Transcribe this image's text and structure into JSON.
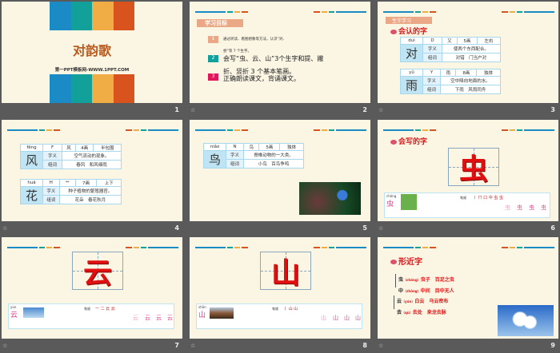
{
  "colors": {
    "blue": "#1a8bc4",
    "teal": "#12a09a",
    "yellow": "#f0ad45",
    "red": "#d9531e",
    "title": "#b85a1e",
    "accent_red": "#d81818"
  },
  "transition_icon": "animation-star-icon",
  "slides": [
    {
      "number": "1",
      "title": "对韵歌",
      "subtitle": "第一PPT模板网-WWW.1PPT.COM"
    },
    {
      "number": "2",
      "badge": "学习目标",
      "goals": [
        {
          "n": "1",
          "text": "通过听读、看图想象等方法，认识“对、",
          "text2": "尝”等 7 个生字。"
        },
        {
          "n": "2",
          "text": "会写“虫、云、山”3个生字和提、撇",
          "text2": "折、竖折 3 个基本笔画。"
        },
        {
          "n": "3",
          "text": "正确朗读课文，背诵课文。"
        }
      ]
    },
    {
      "number": "3",
      "badge": "生字学习",
      "section": "会认的字",
      "chars": [
        {
          "pinyin": "duì",
          "letter": "D",
          "radical": "又",
          "strokes": "5画",
          "structure": "左右",
          "char": "对",
          "meaning_label": "字义",
          "meaning": "使两个东西配合。",
          "words_label": "组词",
          "words": "对错　门当户对"
        },
        {
          "pinyin": "yǔ",
          "letter": "Y",
          "radical": "雨",
          "strokes": "8画",
          "structure": "独体",
          "char": "雨",
          "meaning_label": "字义",
          "meaning": "空中降向地面的水。",
          "words_label": "组词",
          "words": "下雨　风雨同舟"
        }
      ]
    },
    {
      "number": "4",
      "chars": [
        {
          "pinyin": "fēng",
          "letter": "F",
          "radical": "风",
          "strokes": "4画",
          "structure": "半包围",
          "char": "风",
          "meaning_label": "字义",
          "meaning": "空气流动的现象。",
          "words_label": "组词",
          "words": "春风　和风细雨"
        },
        {
          "pinyin": "huā",
          "letter": "H",
          "radical": "艹",
          "strokes": "7画",
          "structure": "上下",
          "char": "花",
          "meaning_label": "字义",
          "meaning": "种子植物的繁殖器官。",
          "words_label": "组词",
          "words": "花朵　春花秋月"
        }
      ]
    },
    {
      "number": "5",
      "chars": [
        {
          "pinyin": "niǎo",
          "letter": "N",
          "radical": "鸟",
          "strokes": "5画",
          "structure": "独体",
          "char": "鸟",
          "meaning_label": "字义",
          "meaning": "脊椎动物的一大类。",
          "words_label": "组词",
          "words": "小鸟　百鸟争鸣"
        }
      ]
    },
    {
      "number": "6",
      "section": "会写的字",
      "char": "虫",
      "pinyin": "chóng",
      "stroke_order": "丨 ㄇ 口 中 虫 虫",
      "strip_label": "笔顺",
      "practice": [
        "虫",
        "虫",
        "虫",
        "虫"
      ]
    },
    {
      "number": "7",
      "char": "云",
      "pinyin": "yún",
      "stroke_order": "一 二 云 云",
      "strip_label": "笔顺",
      "practice": [
        "云",
        "云",
        "云",
        "云"
      ]
    },
    {
      "number": "8",
      "char": "山",
      "pinyin": "shān",
      "stroke_order": "丨 山 山",
      "strip_label": "笔顺",
      "practice": [
        "山",
        "山",
        "山",
        "山"
      ]
    },
    {
      "number": "9",
      "section": "形近字",
      "pairs": [
        {
          "char": "虫",
          "pinyin": "（chóng）",
          "words": "虫子　百足之虫"
        },
        {
          "char": "中",
          "pinyin": "（zhōng）",
          "words": "中间　目中无人"
        },
        {
          "char": "云",
          "pinyin": "（yún）",
          "words": "白云　乌云密布"
        },
        {
          "char": "去",
          "pinyin": "（qù）",
          "words": "去处　来龙去脉"
        }
      ]
    }
  ]
}
